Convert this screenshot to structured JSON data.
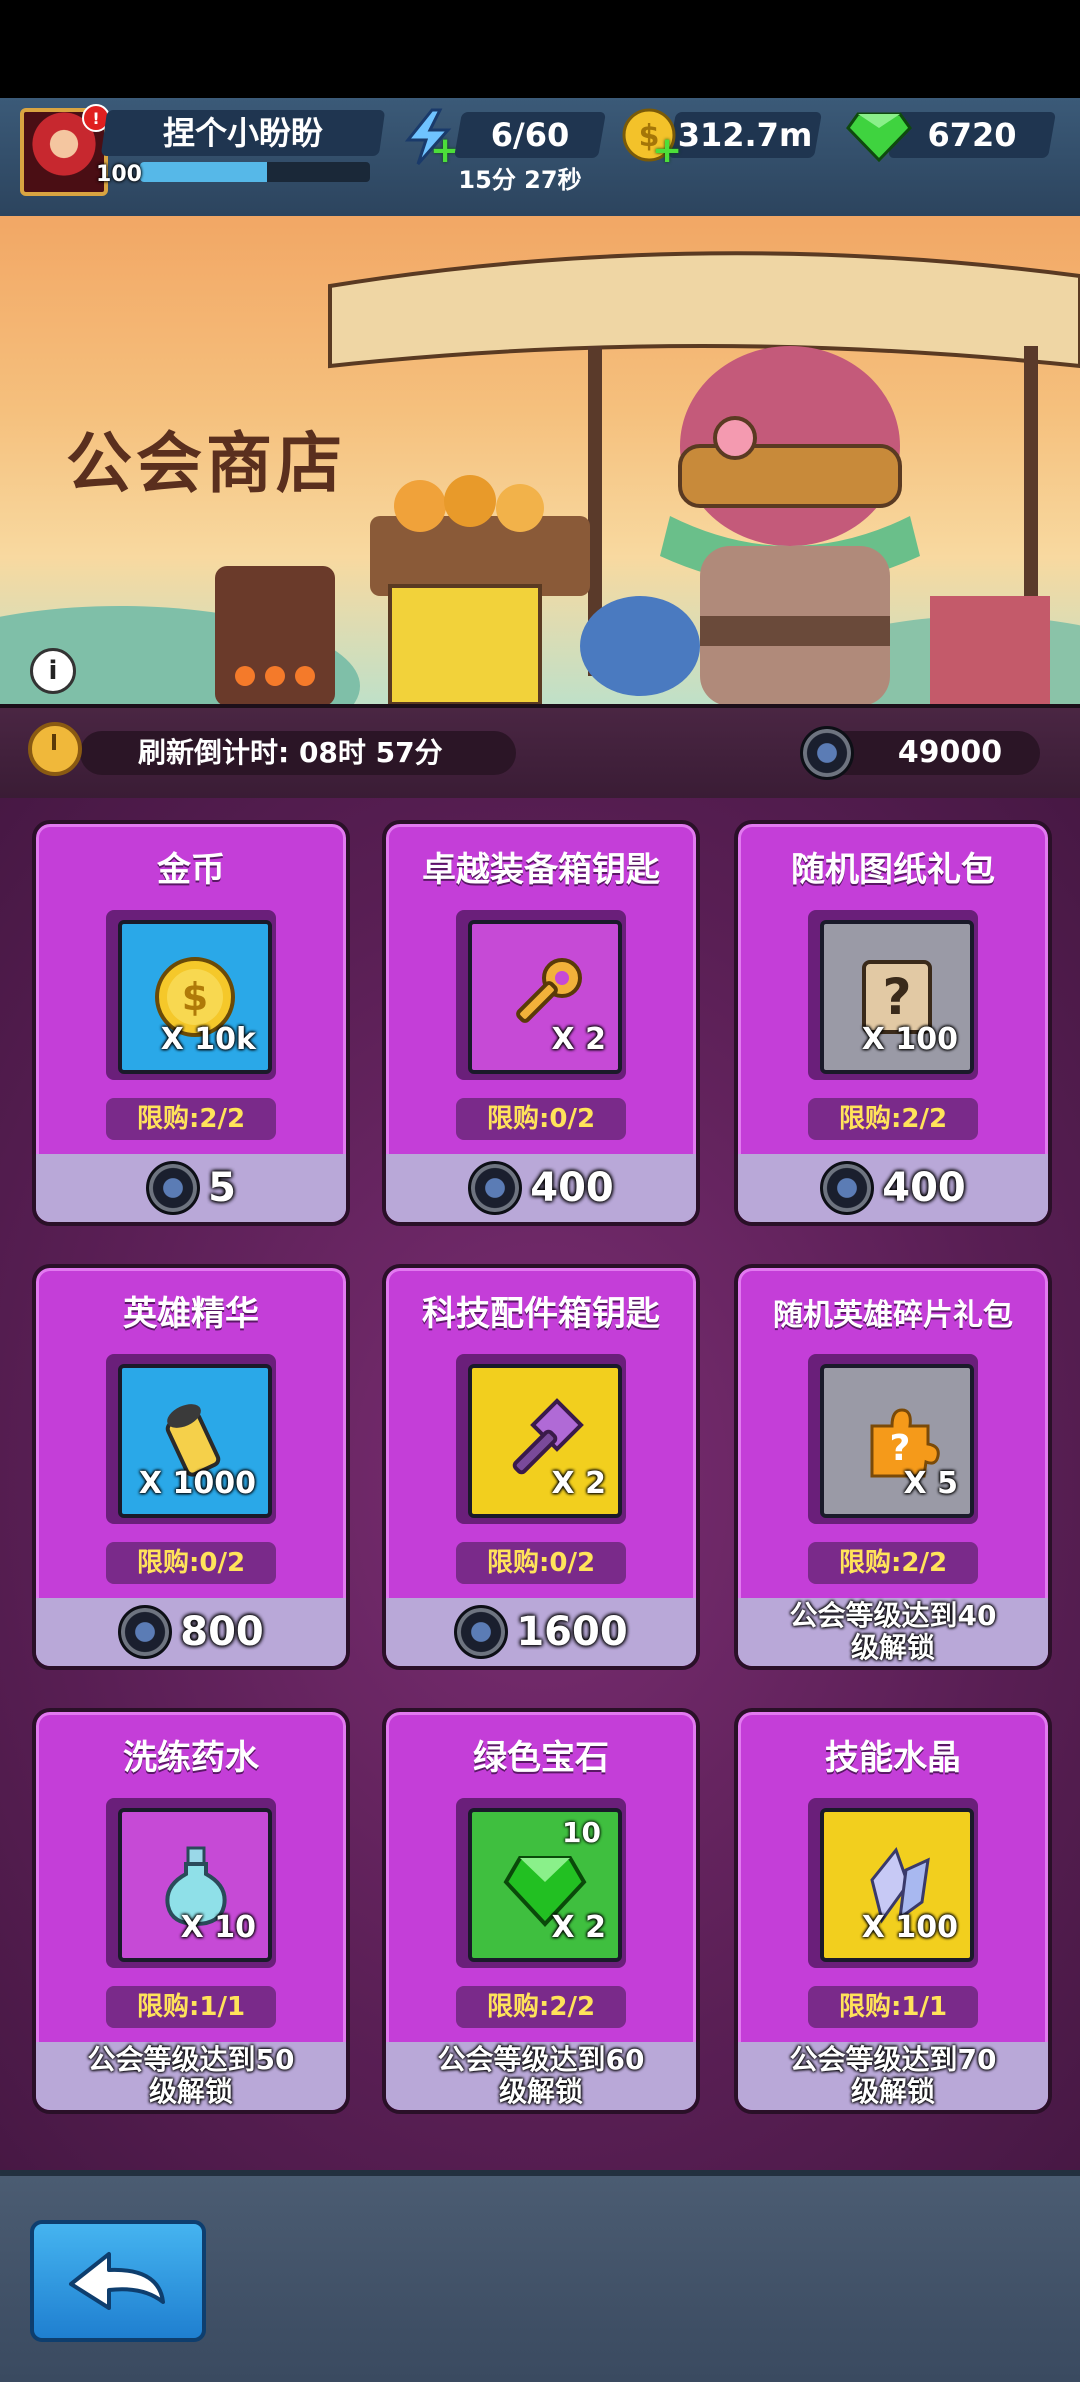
{
  "player": {
    "name": "捏个小盼盼",
    "level": "100",
    "xp_fraction": 0.55
  },
  "resources": {
    "energy": "6/60",
    "energy_timer": "15分 27秒",
    "gold": "312.7m",
    "gems": "6720"
  },
  "banner": {
    "title": "公会商店"
  },
  "refresh": {
    "label": "刷新倒计时: 08时 57分"
  },
  "guild_tokens": "49000",
  "items": [
    {
      "title": "金币",
      "qty": "X 10k",
      "limit": "限购:2/2",
      "price": "5",
      "icon": "gold-coin-icon",
      "box_color": "#2aa8e8"
    },
    {
      "title": "卓越装备箱钥匙",
      "qty": "X 2",
      "limit": "限购:0/2",
      "price": "400",
      "icon": "key-icon",
      "box_color": "#c64ad6"
    },
    {
      "title": "随机图纸礼包",
      "qty": "X 100",
      "limit": "限购:2/2",
      "price": "400",
      "icon": "mystery-blueprint-icon",
      "box_color": "#9a9aa6"
    },
    {
      "title": "英雄精华",
      "qty": "X 1000",
      "limit": "限购:0/2",
      "price": "800",
      "icon": "hero-essence-icon",
      "box_color": "#2aa8e8"
    },
    {
      "title": "科技配件箱钥匙",
      "qty": "X 2",
      "limit": "限购:0/2",
      "price": "1600",
      "icon": "tech-key-icon",
      "box_color": "#f2cf1e"
    },
    {
      "title": "随机英雄碎片礼包",
      "qty": "X 5",
      "limit": "限购:2/2",
      "unlock": "公会等级达到40级解锁",
      "icon": "hero-shard-icon",
      "box_color": "#9a9aa6"
    },
    {
      "title": "洗练药水",
      "qty": "X 10",
      "limit": "限购:1/1",
      "unlock": "公会等级达到50级解锁",
      "icon": "potion-icon",
      "box_color": "#c64ad6"
    },
    {
      "title": "绿色宝石",
      "qty": "X 2",
      "extra": "10",
      "limit": "限购:2/2",
      "unlock": "公会等级达到60级解锁",
      "icon": "green-gem-icon",
      "box_color": "#3fbf3f"
    },
    {
      "title": "技能水晶",
      "qty": "X 100",
      "limit": "限购:1/1",
      "unlock": "公会等级达到70级解锁",
      "icon": "skill-crystal-icon",
      "box_color": "#f2cf1e"
    }
  ]
}
